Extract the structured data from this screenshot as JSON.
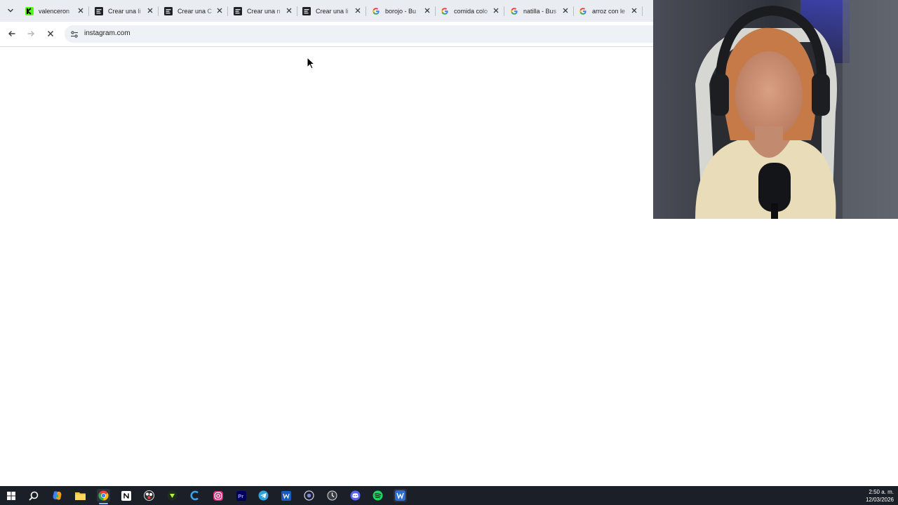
{
  "browser": {
    "tabs": [
      {
        "title": "valenceron",
        "favicon": "kick-icon",
        "color": "#53fc18"
      },
      {
        "title": "Crear una li",
        "favicon": "app-icon"
      },
      {
        "title": "Crear una C",
        "favicon": "app-icon"
      },
      {
        "title": "Crear una n",
        "favicon": "app-icon"
      },
      {
        "title": "Crear una li",
        "favicon": "app-icon"
      },
      {
        "title": "borojo - Bu",
        "favicon": "google-icon"
      },
      {
        "title": "comida colo",
        "favicon": "google-icon"
      },
      {
        "title": "natilla - Bus",
        "favicon": "google-icon"
      },
      {
        "title": "arroz con le",
        "favicon": "google-icon"
      }
    ],
    "address_bar": {
      "url": "instagram.com"
    }
  },
  "taskbar": {
    "icons": [
      "windows-start-icon",
      "search-icon",
      "copilot-icon",
      "file-explorer-icon",
      "chrome-icon",
      "notion-icon",
      "obs-icon",
      "valorant-icon",
      "ccleaner-icon",
      "instagram-icon",
      "premiere-icon",
      "telegram-icon",
      "word-icon",
      "app-icon",
      "app-icon",
      "discord-icon",
      "spotify-icon",
      "app-icon"
    ],
    "clock": {
      "time": "2:50 a. m.",
      "date": "12/03/2026"
    }
  }
}
